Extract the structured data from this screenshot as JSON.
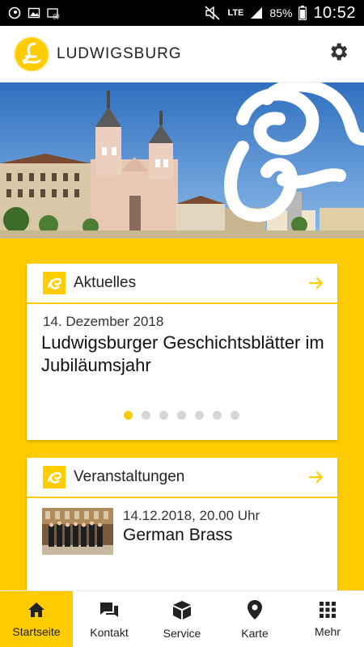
{
  "status_bar": {
    "network": "LTE",
    "battery": "85%",
    "time": "10:52"
  },
  "app_bar": {
    "title": "LUDWIGSBURG",
    "logo_icon": "ludwigsburg-logo-icon",
    "settings_icon": "gear-icon"
  },
  "hero": {
    "image": "ludwigsburg-market-square-photo"
  },
  "news_card": {
    "title": "Aktuelles",
    "date": "14. Dezember 2018",
    "headline": "Ludwigsburger Geschichtsblätter im Jubiläumsjahr",
    "pager": {
      "count": 7,
      "active": 0
    }
  },
  "events_card": {
    "title": "Veranstaltungen",
    "date": "14.12.2018, 20.00 Uhr",
    "event_title": "German Brass"
  },
  "bottom_nav": {
    "items": [
      {
        "label": "Startseite",
        "icon": "home-icon",
        "active": true
      },
      {
        "label": "Kontakt",
        "icon": "chat-icon",
        "active": false
      },
      {
        "label": "Service",
        "icon": "box-icon",
        "active": false
      },
      {
        "label": "Karte",
        "icon": "map-pin-icon",
        "active": false
      },
      {
        "label": "Mehr",
        "icon": "grid-icon",
        "active": false
      }
    ]
  },
  "colors": {
    "accent": "#ffcc00",
    "text": "#222222"
  }
}
